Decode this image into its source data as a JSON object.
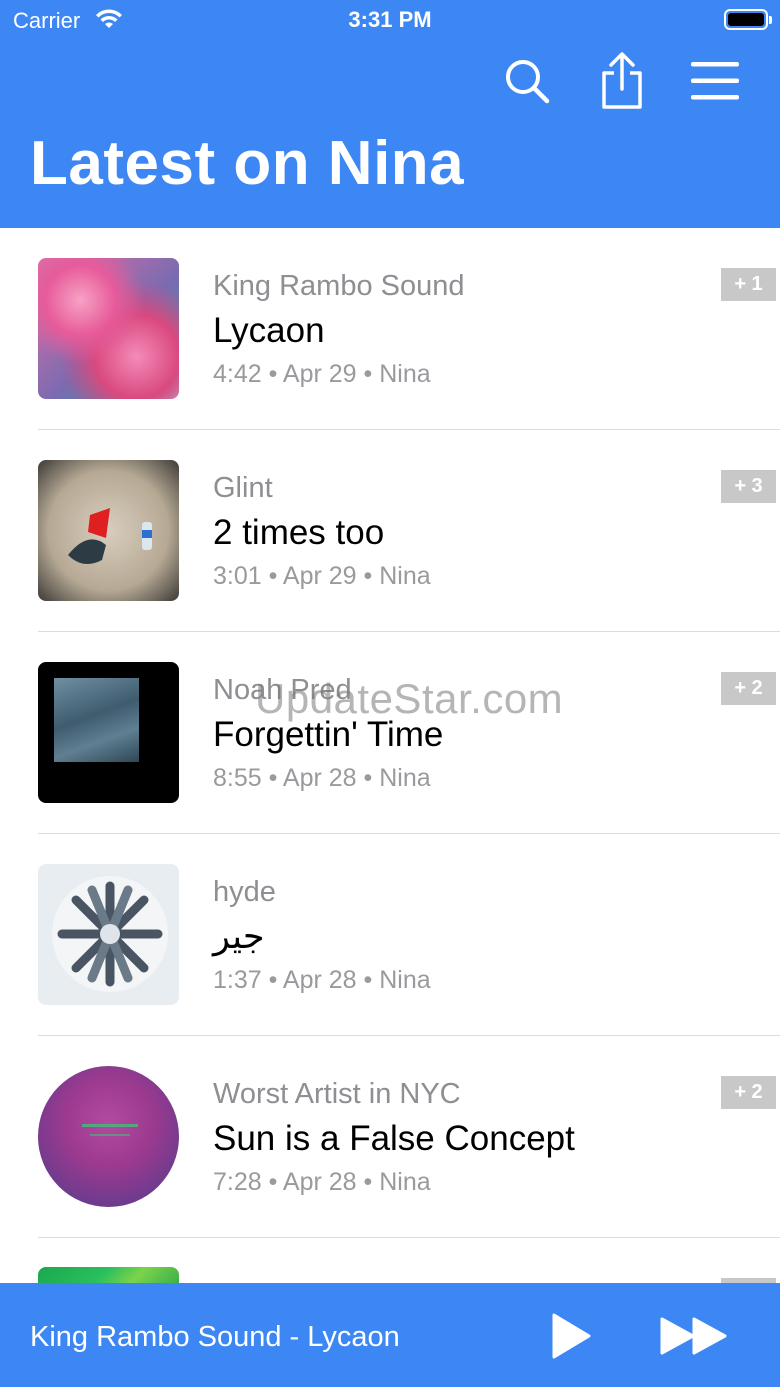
{
  "status_bar": {
    "carrier": "Carrier",
    "time": "3:31 PM"
  },
  "header": {
    "title": "Latest on Nina",
    "icons": [
      "search-icon",
      "share-icon",
      "menu-icon"
    ],
    "background_color": "#3d87f5"
  },
  "releases": [
    {
      "artist": "King Rambo Sound",
      "title": "Lycaon",
      "meta": "4:42 • Apr 29 • Nina",
      "badge": "+ 1"
    },
    {
      "artist": "Glint",
      "title": "2 times too",
      "meta": "3:01 • Apr 29 • Nina",
      "badge": "+ 3"
    },
    {
      "artist": "Noah Pred",
      "title": "Forgettin' Time",
      "meta": "8:55 • Apr 28 • Nina",
      "badge": "+ 2"
    },
    {
      "artist": "hyde",
      "title": "جير",
      "meta": "1:37 • Apr 28 • Nina",
      "badge": ""
    },
    {
      "artist": "Worst Artist in NYC",
      "title": "Sun is a False Concept",
      "meta": "7:28 • Apr 28 • Nina",
      "badge": "+ 2"
    }
  ],
  "watermark": "UpdateStar.com",
  "player": {
    "now_playing": "King Rambo Sound - Lycaon",
    "icons": [
      "play-icon",
      "fast-forward-icon"
    ]
  }
}
